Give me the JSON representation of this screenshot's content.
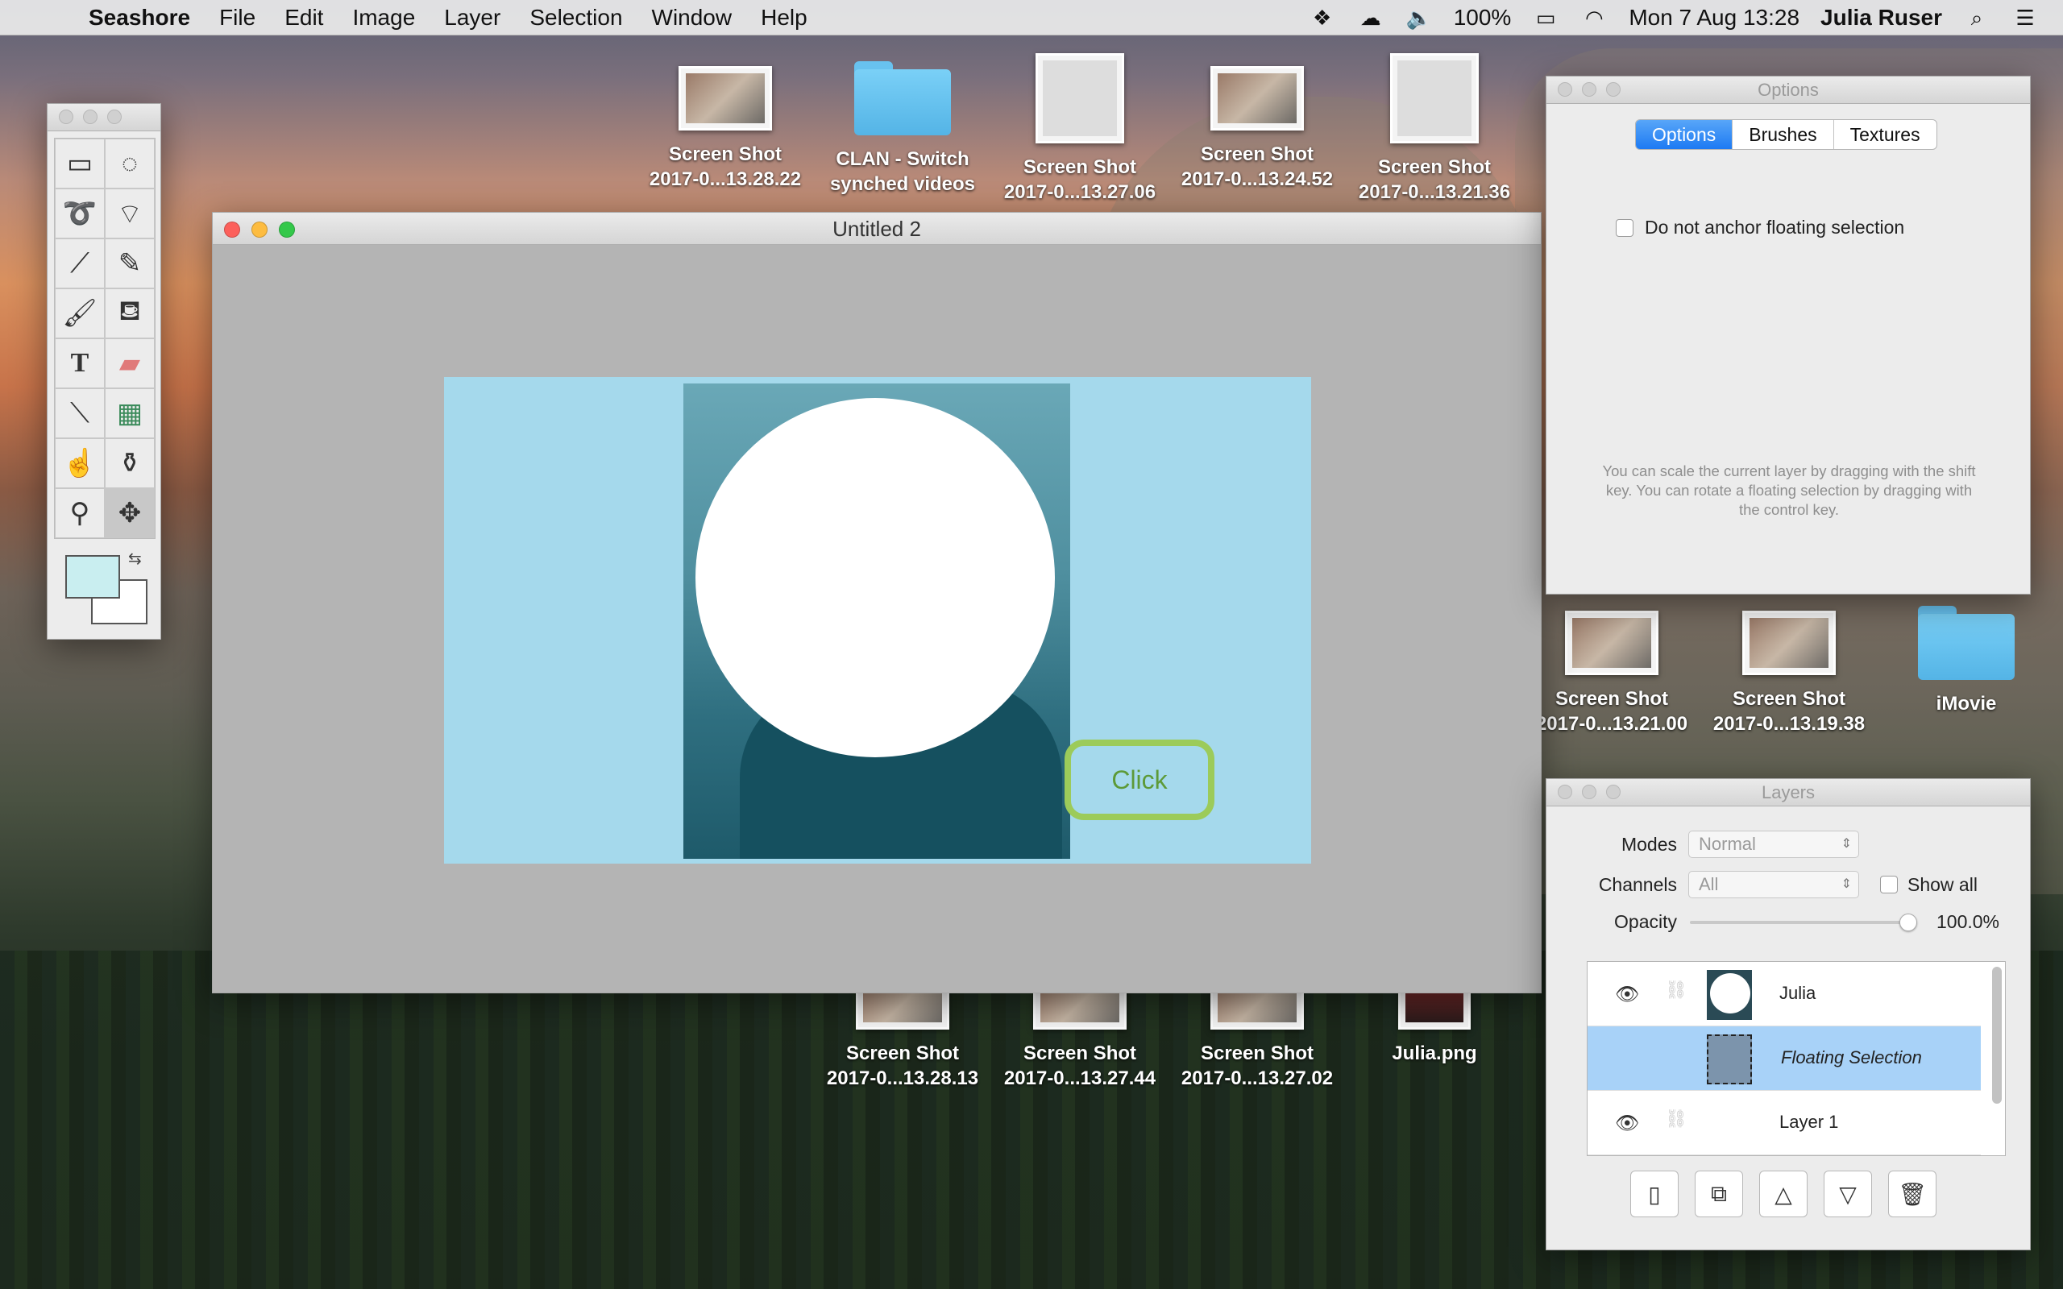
{
  "menubar": {
    "app_name": "Seashore",
    "items": [
      "File",
      "Edit",
      "Image",
      "Layer",
      "Selection",
      "Window",
      "Help"
    ],
    "battery": "100%",
    "datetime": "Mon 7 Aug  13:28",
    "user": "Julia Ruser"
  },
  "desktop_icons": {
    "top": [
      {
        "line1": "Screen Shot",
        "line2": "2017-0...13.28.22"
      },
      {
        "line1": "CLAN - Switch",
        "line2": "synched videos"
      },
      {
        "line1": "Screen Shot",
        "line2": "2017-0...13.27.06"
      },
      {
        "line1": "Screen Shot",
        "line2": "2017-0...13.24.52"
      },
      {
        "line1": "Screen Shot",
        "line2": "2017-0...13.21.36"
      }
    ],
    "right": [
      {
        "line1": "Screen Shot",
        "line2": "2017-0...13.21.00"
      },
      {
        "line1": "Screen Shot",
        "line2": "2017-0...13.19.38"
      },
      {
        "line1": "iMovie",
        "line2": ""
      }
    ],
    "bottom": [
      {
        "line1": "Screen Shot",
        "line2": "2017-0...13.28.13"
      },
      {
        "line1": "Screen Shot",
        "line2": "2017-0...13.27.44"
      },
      {
        "line1": "Screen Shot",
        "line2": "2017-0...13.27.02"
      },
      {
        "line1": "Julia.png",
        "line2": ""
      }
    ]
  },
  "document": {
    "title": "Untitled 2",
    "button_text": "Click"
  },
  "options_panel": {
    "title": "Options",
    "tabs": [
      "Options",
      "Brushes",
      "Textures"
    ],
    "selected_tab": "Options",
    "checkbox_label": "Do not anchor floating selection",
    "help_text": "You can scale the current layer by dragging with the shift key. You can rotate a floating selection by dragging with the control key."
  },
  "layers_panel": {
    "title": "Layers",
    "modes_label": "Modes",
    "modes_value": "Normal",
    "channels_label": "Channels",
    "channels_value": "All",
    "show_all_label": "Show all",
    "opacity_label": "Opacity",
    "opacity_value": "100.0%",
    "opacity_fraction": 1.0,
    "layers": [
      {
        "name": "Julia",
        "visible": true,
        "selected": false
      },
      {
        "name": "Floating Selection",
        "visible": false,
        "selected": true
      },
      {
        "name": "Layer 1",
        "visible": true,
        "selected": false
      }
    ]
  },
  "toolbox": {
    "foreground_color": "#c9eef0",
    "background_color": "#ffffff",
    "tools": [
      "rect-select-icon",
      "ellipse-select-icon",
      "lasso-icon",
      "polygon-lasso-icon",
      "magic-wand-icon",
      "pencil-icon",
      "brush-icon",
      "bucket-icon",
      "text-icon",
      "eraser-icon",
      "eyedropper-icon",
      "gradient-icon",
      "smudge-icon",
      "clone-stamp-icon",
      "zoom-icon",
      "move-icon"
    ],
    "active_tool": "move-icon"
  }
}
